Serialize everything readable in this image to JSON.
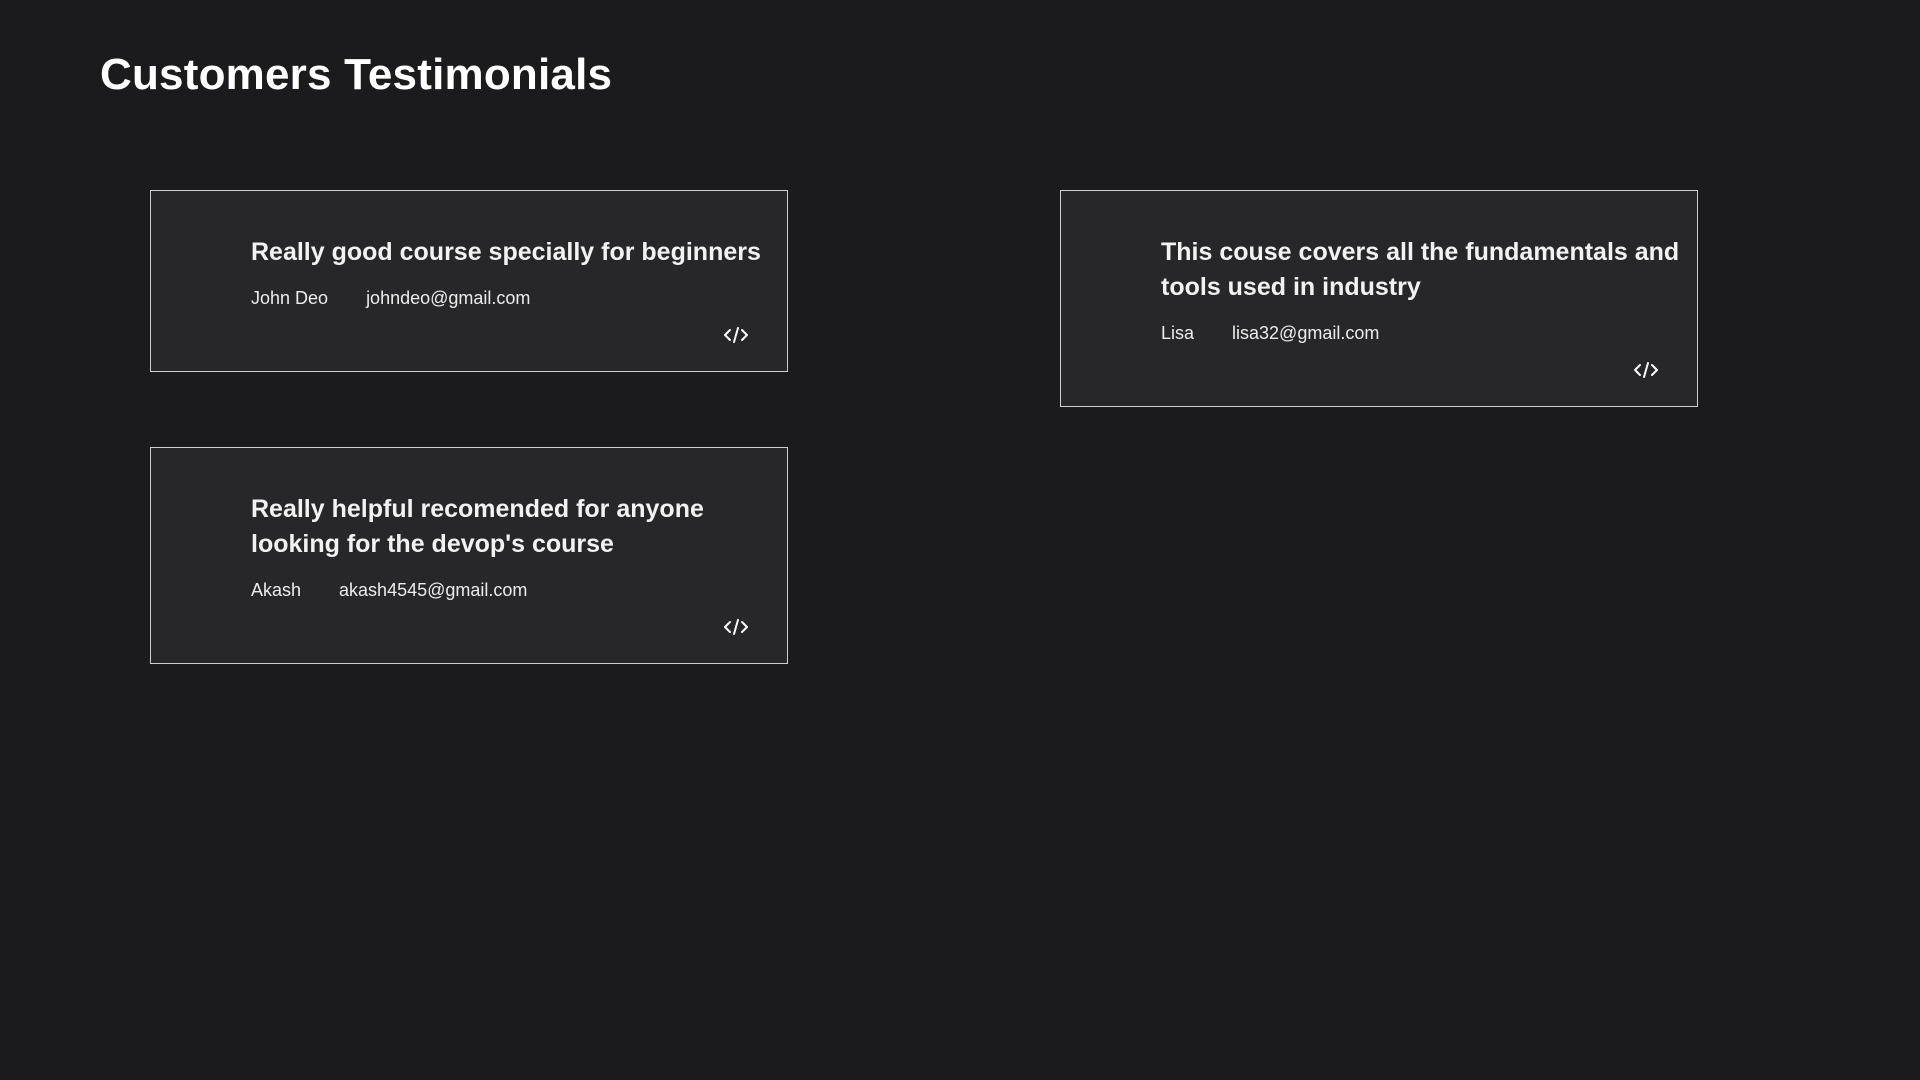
{
  "page": {
    "title": "Customers Testimonials"
  },
  "testimonials": [
    {
      "text": "Really good course specially for beginners",
      "name": "John Deo",
      "email": "johndeo@gmail.com",
      "icon": "code-icon"
    },
    {
      "text": "This couse covers all the fundamentals and tools used in industry",
      "name": "Lisa",
      "email": "lisa32@gmail.com",
      "icon": "code-icon"
    },
    {
      "text": "Really helpful recomended for anyone looking for the devop's course",
      "name": "Akash",
      "email": "akash4545@gmail.com",
      "icon": "code-icon"
    }
  ],
  "colors": {
    "background": "#1b1b1d",
    "card_background": "#27272a",
    "card_border": "#cfcfd2",
    "text": "#ffffff"
  }
}
